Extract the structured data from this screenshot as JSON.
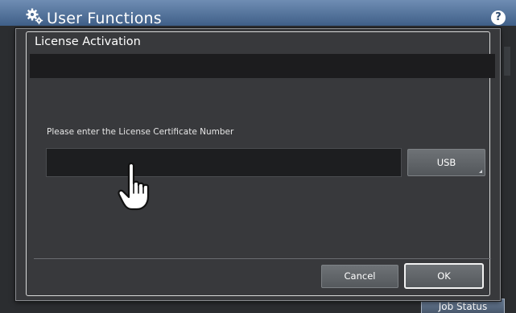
{
  "app": {
    "title": "User Functions",
    "help_icon": "help-icon",
    "help_glyph": "?"
  },
  "dialog": {
    "title": "License Activation",
    "prompt": "Please enter the License Certificate Number",
    "license_input": {
      "value": "",
      "placeholder": ""
    },
    "usb_label": "USB",
    "cancel_label": "Cancel",
    "ok_label": "OK"
  },
  "background": {
    "job_status_label": "Job Status"
  },
  "icons": {
    "settings": "gear-icon",
    "pointer": "hand-pointer-icon"
  },
  "colors": {
    "header_top": "#6f8db3",
    "header_bottom": "#3f5f88",
    "dialog_bg": "#38393c",
    "input_bg": "#1d1e20",
    "button_bg": "#606468",
    "ok_border": "#f2f2f2"
  }
}
